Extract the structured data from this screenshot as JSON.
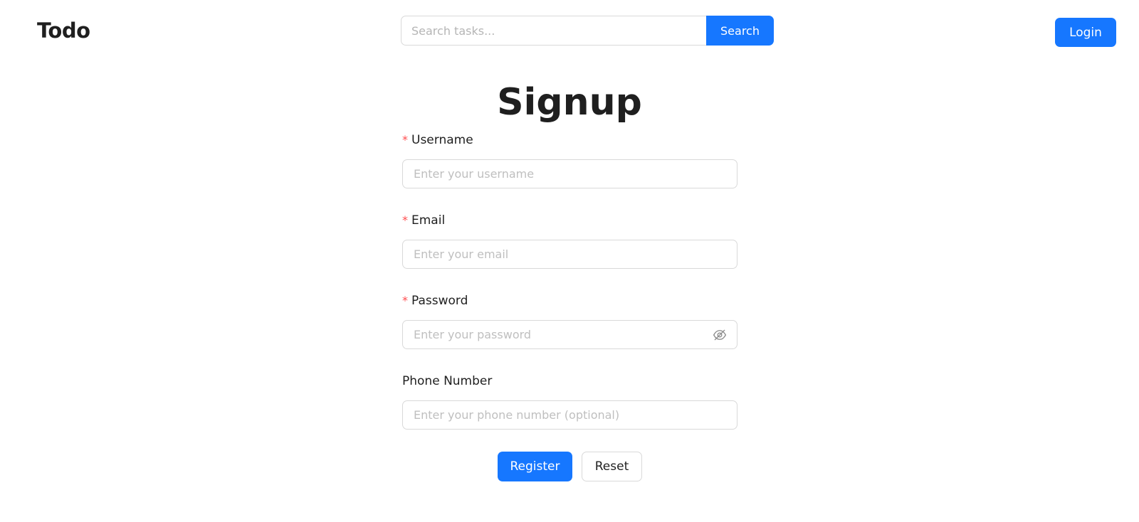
{
  "header": {
    "logo": "Todo",
    "search": {
      "placeholder": "Search tasks...",
      "value": "",
      "button_label": "Search"
    },
    "login_label": "Login"
  },
  "page": {
    "title": "Signup"
  },
  "form": {
    "required_mark": "*",
    "username": {
      "label": "Username",
      "required": true,
      "placeholder": "Enter your username",
      "value": ""
    },
    "email": {
      "label": "Email",
      "required": true,
      "placeholder": "Enter your email",
      "value": ""
    },
    "password": {
      "label": "Password",
      "required": true,
      "placeholder": "Enter your password",
      "value": "",
      "toggle_icon": "eye-invisible-icon"
    },
    "phone": {
      "label": "Phone Number",
      "required": false,
      "placeholder": "Enter your phone number (optional)",
      "value": ""
    },
    "register_label": "Register",
    "reset_label": "Reset"
  },
  "colors": {
    "primary": "#1677ff",
    "required": "#ff4d4f",
    "border": "#d9d9d9",
    "placeholder": "#bfbfbf"
  }
}
